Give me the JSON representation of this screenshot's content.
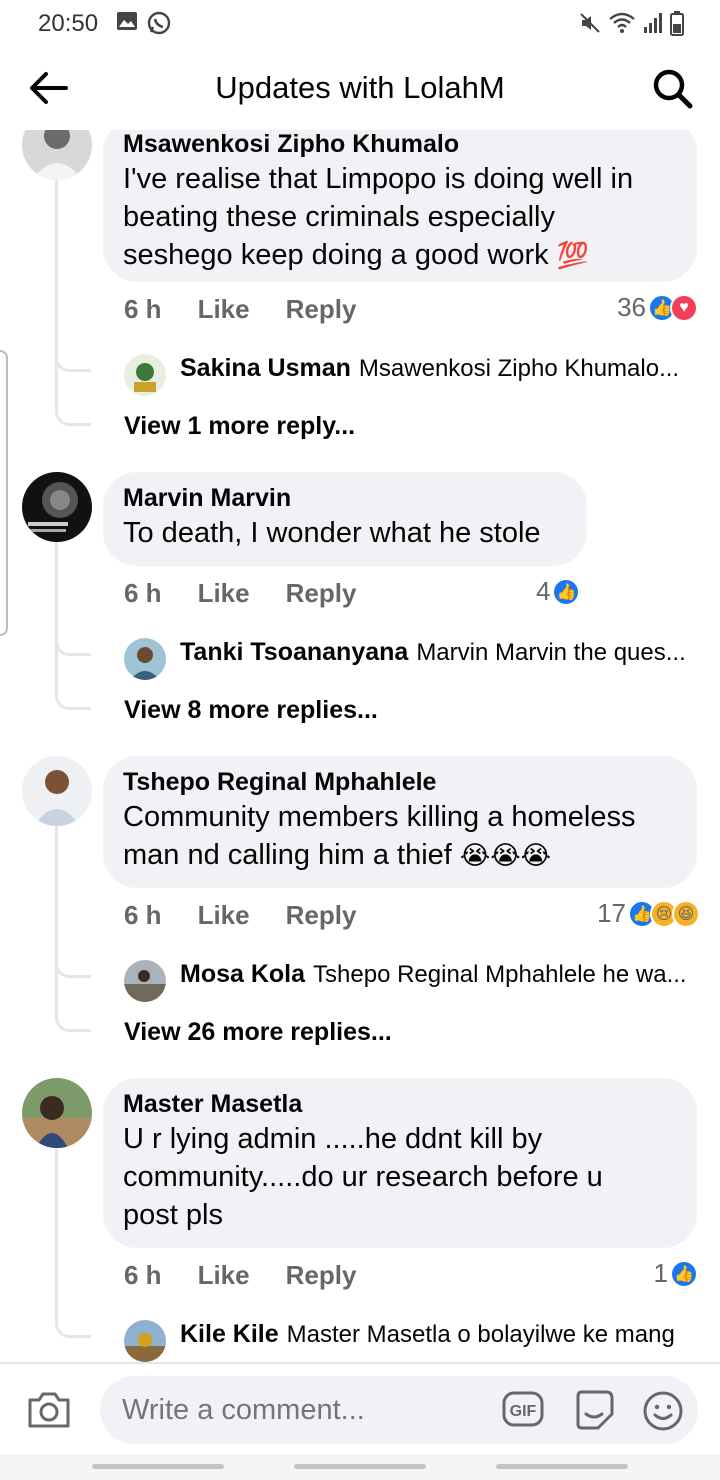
{
  "status_bar": {
    "time": "20:50",
    "left_icons": [
      "gallery-icon",
      "whatsapp-icon"
    ],
    "right_icons": [
      "mute-icon",
      "wifi-icon",
      "signal-icon",
      "battery-icon"
    ]
  },
  "header": {
    "title": "Updates with LolahM",
    "back_icon": "back-arrow-icon",
    "search_icon": "search-icon"
  },
  "comments": [
    {
      "author": "Msawenkosi Zipho Khumalo",
      "lines": [
        "I've realise that Limpopo is doing well in",
        "beating these criminals especially",
        "seshego keep doing a good work"
      ],
      "emoji": "💯",
      "time": "6 h",
      "like": "Like",
      "reply": "Reply",
      "reaction_count": "36",
      "reactions": [
        "like",
        "love"
      ],
      "first_reply": {
        "author": "Sakina Usman",
        "text": "Msawenkosi Zipho Khumalo..."
      },
      "more_replies": "View 1 more reply..."
    },
    {
      "author": "Marvin Marvin",
      "lines": [
        "To death, I wonder what he stole"
      ],
      "emoji": "",
      "time": "6 h",
      "like": "Like",
      "reply": "Reply",
      "reaction_count": "4",
      "reactions": [
        "like"
      ],
      "first_reply": {
        "author": "Tanki Tsoananyana",
        "text": "Marvin Marvin the ques..."
      },
      "more_replies": "View 8 more replies..."
    },
    {
      "author": "Tshepo Reginal Mphahlele",
      "lines": [
        "Community members killing a homeless",
        "man nd calling him a thief"
      ],
      "emoji": "😭😭😭",
      "time": "6 h",
      "like": "Like",
      "reply": "Reply",
      "reaction_count": "17",
      "reactions": [
        "like",
        "sad",
        "haha"
      ],
      "first_reply": {
        "author": "Mosa Kola",
        "text": "Tshepo Reginal Mphahlele he wa..."
      },
      "more_replies": "View 26 more replies..."
    },
    {
      "author": "Master Masetla",
      "lines": [
        "U r lying admin .....he ddnt kill by",
        "community.....do ur research before u",
        "post pls"
      ],
      "emoji": "",
      "time": "6 h",
      "like": "Like",
      "reply": "Reply",
      "reaction_count": "1",
      "reactions": [
        "like"
      ],
      "first_reply": {
        "author": "Kile Kile",
        "text": "Master Masetla o bolayilwe ke mang"
      },
      "more_replies": ""
    }
  ],
  "composer": {
    "placeholder": "Write a comment...",
    "gif_label": "GIF"
  },
  "colors": {
    "like_blue": "#1877f2",
    "love_red": "#f33e58",
    "bubble_bg": "#f0f2f5",
    "meta_gray": "#65676b"
  }
}
